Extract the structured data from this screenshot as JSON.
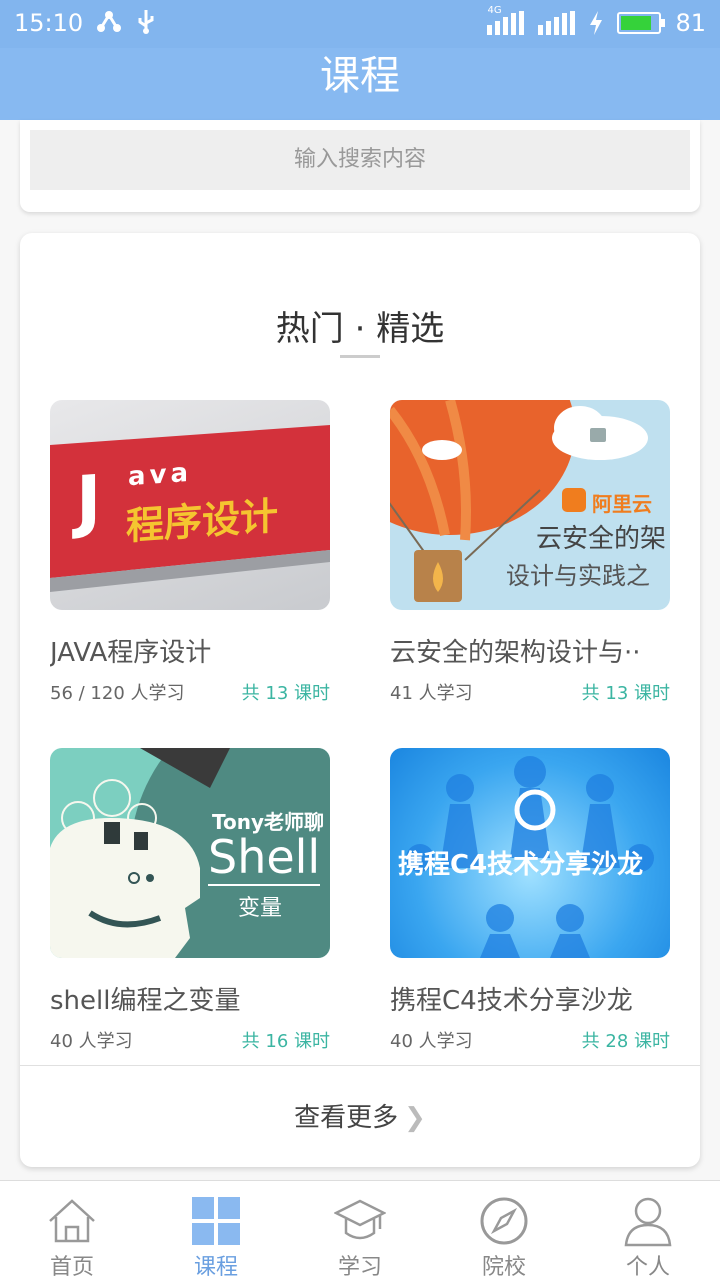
{
  "status_bar": {
    "time": "15:10",
    "network": "4G",
    "battery": "81",
    "battery_level": 0.81
  },
  "header": {
    "title": "课程"
  },
  "search": {
    "placeholder": "输入搜索内容"
  },
  "section": {
    "title": "热门 · 精选",
    "more_label": "查看更多"
  },
  "courses": [
    {
      "name": "JAVA程序设计",
      "learners": "56 / 120 人学习",
      "lessons": "共 13 课时",
      "thumb": {
        "line1": "ava",
        "line2": "程序设计",
        "letter": "J"
      }
    },
    {
      "name": "云安全的架构设计与··",
      "learners": "41 人学习",
      "lessons": "共 13 课时",
      "thumb": {
        "brand": "阿里云",
        "line1": "云安全的架",
        "line2": "设计与实践之"
      }
    },
    {
      "name": "shell编程之变量",
      "learners": "40 人学习",
      "lessons": "共 16 课时",
      "thumb": {
        "line1": "Tony老师聊",
        "line2": "Shell",
        "line3": "变量"
      }
    },
    {
      "name": "携程C4技术分享沙龙",
      "learners": "40 人学习",
      "lessons": "共 28 课时",
      "thumb": {
        "line1": "携程C4技术分享沙龙"
      }
    }
  ],
  "tabs": [
    {
      "label": "首页",
      "icon": "home-icon"
    },
    {
      "label": "课程",
      "icon": "grid-icon",
      "active": true
    },
    {
      "label": "学习",
      "icon": "graduation-cap-icon"
    },
    {
      "label": "院校",
      "icon": "compass-icon"
    },
    {
      "label": "个人",
      "icon": "person-icon"
    }
  ],
  "colors": {
    "header": "#87b9f1",
    "accent": "#6a9fe0",
    "lessons": "#3bb5a2"
  }
}
